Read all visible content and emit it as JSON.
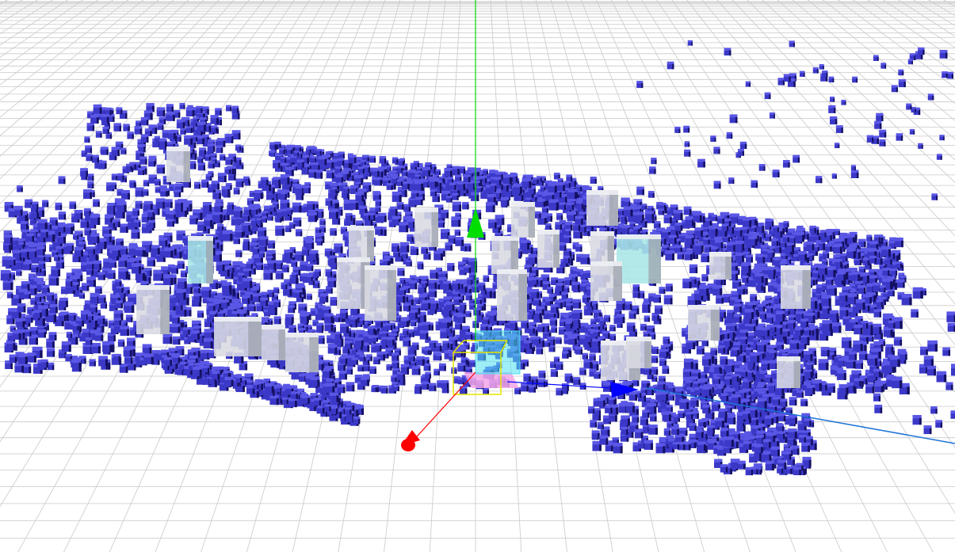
{
  "viewer": {
    "background": "#ffffff",
    "grid_color": "#c9c9c9",
    "occupied_voxel_color": "#3b38c8",
    "occupied_voxel_top_color": "#5a57e6",
    "occupied_voxel_shadow_color": "#141060",
    "obstacle_box_color": "#d9dbe3",
    "highlight_box_color": "#a8e6e6",
    "axes": {
      "x": {
        "color": "#ff0000",
        "icon": "red-cone-arrow-icon"
      },
      "y": {
        "color": "#00dd00",
        "icon": "green-cone-arrow-icon"
      },
      "z": {
        "color": "#0000ff",
        "icon": "blue-cone-arrow-icon"
      }
    },
    "robot_marker": {
      "icon": "robot-footprint-icon",
      "outline_color": "#e6e600",
      "fill_color": "#f4a6e8",
      "volume_color": "#4fe0f0"
    },
    "path_line_color": "#1e73d8"
  }
}
